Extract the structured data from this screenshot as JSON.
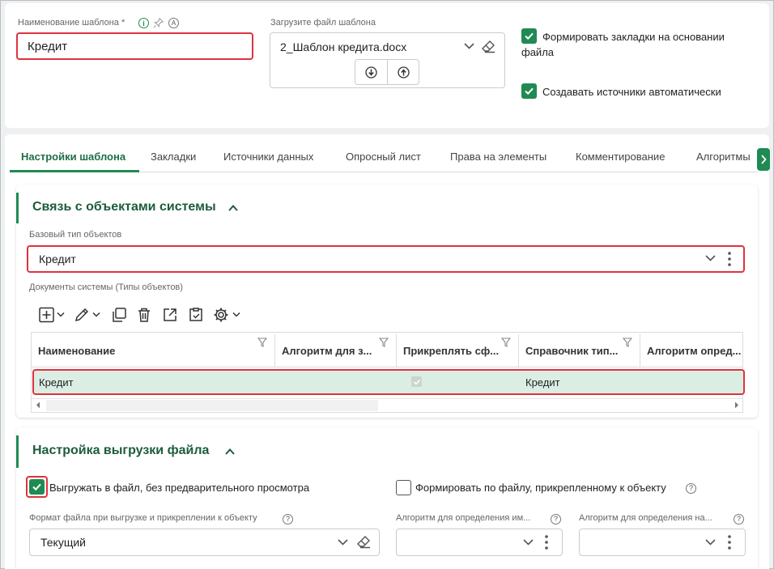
{
  "top": {
    "template_name_label": "Наименование шаблона *",
    "template_name_value": "Кредит",
    "upload_label": "Загрузите файл шаблона",
    "file_name": "2_Шаблон кредита.docx",
    "bookmarks_checkbox_label_line1": "Формировать закладки на основании",
    "bookmarks_checkbox_label_line2": "файла",
    "sources_checkbox_label": "Создавать источники автоматически",
    "info_icon_letter": "i",
    "a_icon_letter": "A"
  },
  "tabs": [
    {
      "label": "Настройки шаблона"
    },
    {
      "label": "Закладки"
    },
    {
      "label": "Источники данных"
    },
    {
      "label": "Опросный лист"
    },
    {
      "label": "Права на элементы"
    },
    {
      "label": "Комментирование"
    },
    {
      "label": "Алгоритмы"
    }
  ],
  "section1": {
    "title": "Связь с объектами системы",
    "base_type_label": "Базовый тип объектов",
    "base_type_value": "Кредит",
    "docs_label": "Документы системы (Типы объектов)",
    "columns": [
      "Наименование",
      "Алгоритм для з...",
      "Прикреплять сф...",
      "Справочник тип...",
      "Алгоритм опред..."
    ],
    "rows": [
      {
        "name": "Кредит",
        "algorithm": "",
        "attach_checked": true,
        "reference": "Кредит",
        "algorithm2": ""
      }
    ]
  },
  "section2": {
    "title": "Настройка выгрузки файла",
    "export_checkbox_label": "Выгружать в файл, без предварительного просмотра",
    "form_by_file_label": "Формировать по файлу, прикрепленному к объекту",
    "format_label": "Формат файла при выгрузке и прикреплении к объекту",
    "format_value": "Текущий",
    "algo_name_label": "Алгоритм для определения им...",
    "algo_name2_label": "Алгоритм для определения на..."
  },
  "colors": {
    "accent": "#1f8a53",
    "highlight_border": "#e0323f",
    "row_selected": "#dbeee3",
    "title_green": "#1d5c3c"
  }
}
